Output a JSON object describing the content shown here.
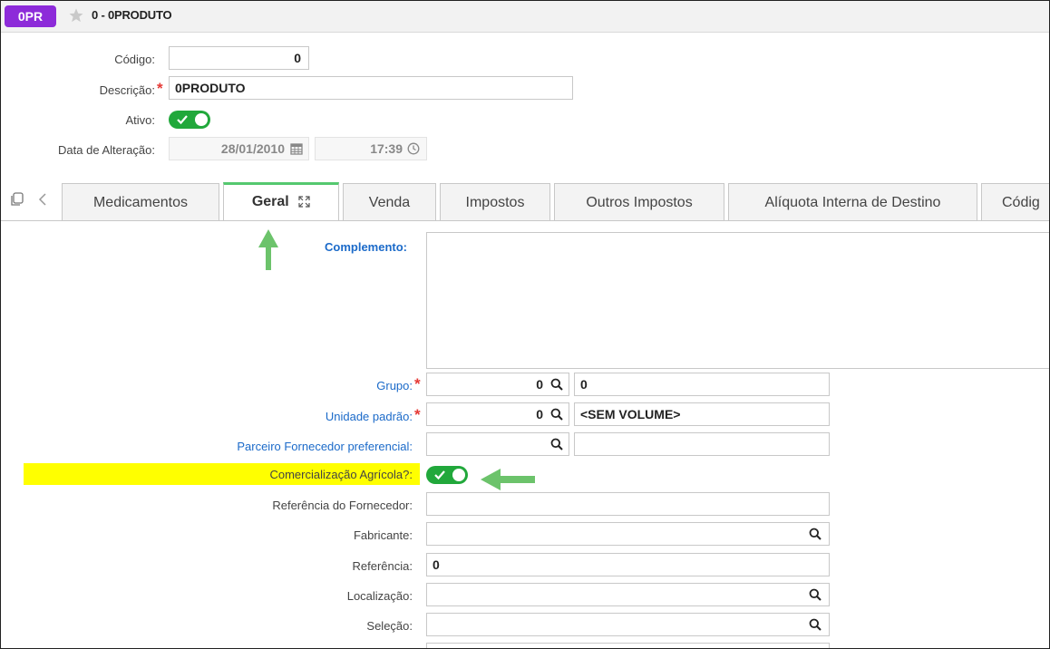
{
  "header": {
    "badge": "0PR",
    "title": "0 - 0PRODUTO"
  },
  "form": {
    "codigo": {
      "label": "Código:",
      "value": "0"
    },
    "descricao": {
      "label": "Descrição:",
      "value": "0PRODUTO"
    },
    "ativo": {
      "label": "Ativo:",
      "checked": true
    },
    "data_alteracao": {
      "label": "Data de Alteração:",
      "date": "28/01/2010",
      "time": "17:39"
    }
  },
  "tabs": [
    {
      "label": "Medicamentos"
    },
    {
      "label": "Geral",
      "active": true
    },
    {
      "label": "Venda"
    },
    {
      "label": "Impostos"
    },
    {
      "label": "Outros Impostos"
    },
    {
      "label": "Alíquota Interna de Destino"
    },
    {
      "label": "Códig"
    }
  ],
  "geral": {
    "complemento": {
      "label": "Complemento:",
      "value": ""
    },
    "grupo": {
      "label": "Grupo:",
      "code": "0",
      "description": "0"
    },
    "unidade": {
      "label": "Unidade padrão:",
      "code": "0",
      "description": "<SEM VOLUME>"
    },
    "parceiro": {
      "label": "Parceiro Fornecedor preferencial:",
      "code": "",
      "description": ""
    },
    "comercializacao": {
      "label": "Comercialização Agrícola?:",
      "checked": true
    },
    "referencia_fornecedor": {
      "label": "Referência do Fornecedor:",
      "value": ""
    },
    "fabricante": {
      "label": "Fabricante:",
      "value": ""
    },
    "referencia": {
      "label": "Referência:",
      "value": "0"
    },
    "localizacao": {
      "label": "Localização:",
      "value": ""
    },
    "selecao": {
      "label": "Seleção:",
      "value": ""
    }
  },
  "colors": {
    "badge": "#8d2bd9",
    "toggle_on": "#21a83b",
    "highlight": "#ffff00",
    "annotation_arrow": "#6cc36b",
    "required": "#e53935",
    "link_label": "#1b6ac9"
  }
}
